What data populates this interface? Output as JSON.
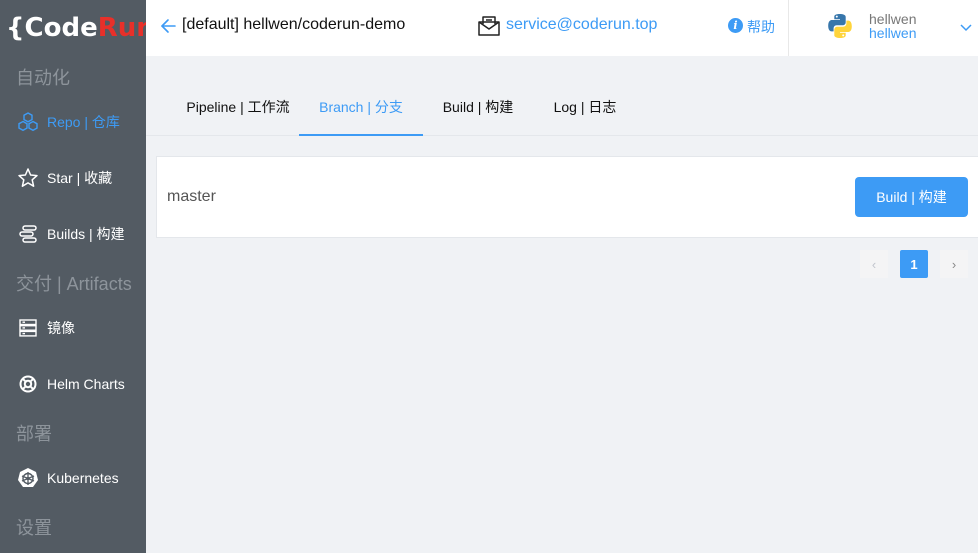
{
  "brand": {
    "logo_open": "{Code",
    "logo_red": "Run",
    "logo_close": "}"
  },
  "sidebar": {
    "sections": [
      {
        "title": "自动化"
      },
      {
        "title": "交付 | Artifacts"
      },
      {
        "title": "部署"
      },
      {
        "title": "设置"
      }
    ],
    "items": [
      {
        "label": "Repo | 仓库",
        "icon": "repo-cubes-icon",
        "active": true
      },
      {
        "label": "Star | 收藏",
        "icon": "star-icon"
      },
      {
        "label": "Builds | 构建",
        "icon": "builds-icon"
      },
      {
        "label": "镜像",
        "icon": "server-stack-icon"
      },
      {
        "label": "Helm Charts",
        "icon": "helm-lifebuoy-icon"
      },
      {
        "label": "Kubernetes",
        "icon": "kubernetes-wheel-icon"
      }
    ]
  },
  "header": {
    "repo_title": "[default] hellwen/coderun-demo",
    "email": "service@coderun.top",
    "help_label": "帮助",
    "user_name": "hellwen",
    "user_login": "hellwen"
  },
  "tabs": [
    {
      "label": "Pipeline | 工作流"
    },
    {
      "label": "Branch | 分支",
      "active": true
    },
    {
      "label": "Build | 构建"
    },
    {
      "label": "Log | 日志"
    }
  ],
  "branches": [
    {
      "name": "master",
      "build_label": "Build | 构建"
    }
  ],
  "pagination": {
    "current": "1",
    "prev": "‹",
    "next": "›"
  },
  "colors": {
    "sidebar_bg": "#535b63",
    "accent": "#3d9bf5",
    "brand_red": "#e8302a"
  }
}
